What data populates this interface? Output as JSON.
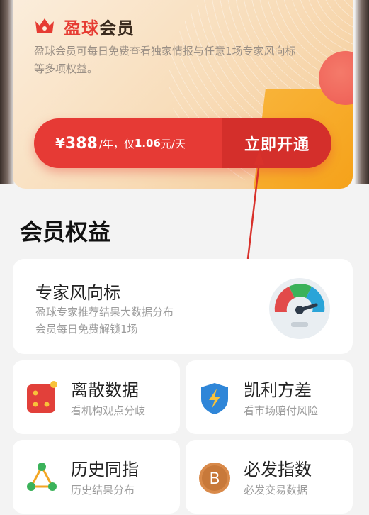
{
  "member_card": {
    "title_part1": "盈球",
    "title_part2": "会员",
    "description": "盈球会员可每日免费查看独家情报与任意1场专家风向标等多项权益。",
    "price_currency": "¥",
    "price_value": "388",
    "price_year_text": "/年，仅",
    "price_per_day": "1.06",
    "price_day_text": "元/天",
    "buy_button_label": "立即开通"
  },
  "section": {
    "title": "会员权益"
  },
  "featured": {
    "title": "专家风向标",
    "desc_line1": "盈球专家推荐结果大数据分布",
    "desc_line2": "会员每日免费解锁1场",
    "icon": "gauge-icon"
  },
  "benefits": [
    {
      "title": "离散数据",
      "desc": "看机构观点分歧",
      "icon": "dice-icon"
    },
    {
      "title": "凯利方差",
      "desc": "看市场赔付风险",
      "icon": "shield-bolt-icon"
    },
    {
      "title": "历史同指",
      "desc": "历史结果分布",
      "icon": "network-icon"
    },
    {
      "title": "必发指数",
      "desc": "必发交易数据",
      "icon": "b-coin-icon",
      "icon_letter": "B"
    }
  ],
  "colors": {
    "accent_red": "#e63a35",
    "button_dark_red": "#d42f2b",
    "card_gold": "#f6a623"
  }
}
